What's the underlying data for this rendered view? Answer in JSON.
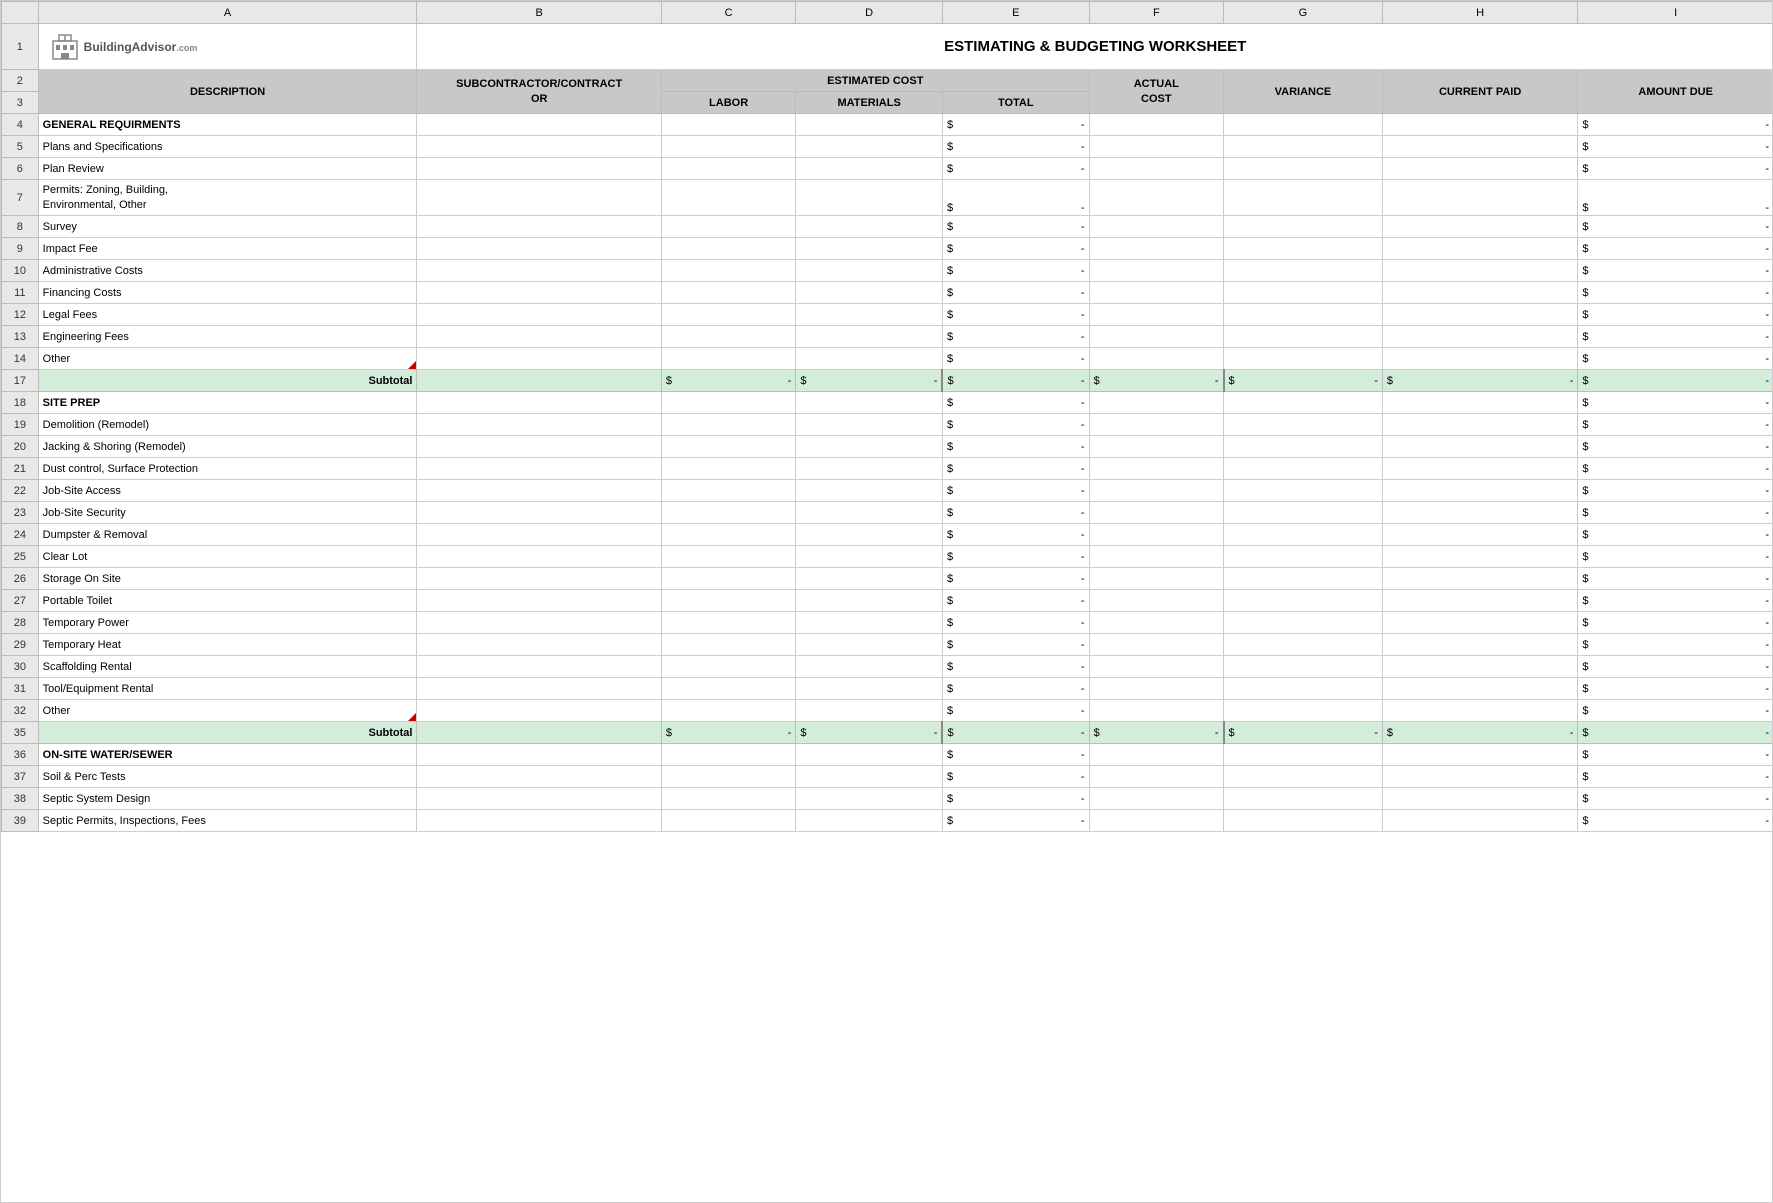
{
  "title": "ESTIMATING & BUDGETING WORKSHEET",
  "logo": {
    "text": "BuildingAdvisor",
    "domain": ".com"
  },
  "columns": {
    "letters": [
      "",
      "A",
      "B",
      "C",
      "D",
      "E",
      "F",
      "G",
      "H",
      "I"
    ],
    "headers_row2": {
      "a": "DESCRIPTION",
      "b": "SUBCONTRACTOR/CONTRACT OR",
      "estimated_cost": "ESTIMATED COST",
      "f": "ACTUAL COST",
      "g": "VARIANCE",
      "h": "CURRENT PAID",
      "i": "AMOUNT DUE"
    },
    "headers_row3": {
      "c": "LABOR",
      "d": "MATERIALS",
      "e": "TOTAL"
    }
  },
  "sections": [
    {
      "name": "GENERAL REQUIRMENTS",
      "row_start": 4,
      "items": [
        {
          "row": 4,
          "label": "GENERAL REQUIRMENTS",
          "bold": true,
          "total": "$ -",
          "amount_due": "$ -"
        },
        {
          "row": 5,
          "label": "Plans and Specifications",
          "total": "$ -",
          "amount_due": "$ -"
        },
        {
          "row": 6,
          "label": "Plan Review",
          "total": "$ -",
          "amount_due": "$ -"
        },
        {
          "row": 7,
          "label": "Permits: Zoning, Building,\nEnvironmental, Other",
          "total": "$ -",
          "amount_due": "$ -"
        },
        {
          "row": 8,
          "label": "Survey",
          "total": "$ -",
          "amount_due": "$ -"
        },
        {
          "row": 9,
          "label": "Impact Fee",
          "total": "$ -",
          "amount_due": "$ -"
        },
        {
          "row": 10,
          "label": "Administrative Costs",
          "total": "$ -",
          "amount_due": "$ -"
        },
        {
          "row": 11,
          "label": "Financing Costs",
          "total": "$ -",
          "amount_due": "$ -"
        },
        {
          "row": 12,
          "label": "Legal Fees",
          "total": "$ -",
          "amount_due": "$ -"
        },
        {
          "row": 13,
          "label": "Engineering Fees",
          "total": "$ -",
          "amount_due": "$ -"
        },
        {
          "row": 14,
          "label": "Other",
          "has_triangle": true,
          "total": "$ -",
          "amount_due": "$ -"
        }
      ],
      "subtotal_row": 17,
      "subtotal_values": {
        "labor": "$ -",
        "materials": "$ -",
        "total": "$ -",
        "actual": "$ -",
        "variance": "$ -",
        "current_paid": "$ -",
        "amount_due": "$ -"
      }
    },
    {
      "name": "SITE PREP",
      "row_start": 18,
      "items": [
        {
          "row": 18,
          "label": "SITE PREP",
          "bold": true,
          "total": "$ -",
          "amount_due": "$ -"
        },
        {
          "row": 19,
          "label": "Demolition (Remodel)",
          "total": "$ -",
          "amount_due": "$ -"
        },
        {
          "row": 20,
          "label": "Jacking & Shoring (Remodel)",
          "total": "$ -",
          "amount_due": "$ -"
        },
        {
          "row": 21,
          "label": "Dust control, Surface Protection",
          "total": "$ -",
          "amount_due": "$ -"
        },
        {
          "row": 22,
          "label": "Job-Site Access",
          "total": "$ -",
          "amount_due": "$ -"
        },
        {
          "row": 23,
          "label": "Job-Site Security",
          "total": "$ -",
          "amount_due": "$ -"
        },
        {
          "row": 24,
          "label": "Dumpster & Removal",
          "total": "$ -",
          "amount_due": "$ -"
        },
        {
          "row": 25,
          "label": "Clear Lot",
          "total": "$ -",
          "amount_due": "$ -"
        },
        {
          "row": 26,
          "label": "Storage On Site",
          "total": "$ -",
          "amount_due": "$ -"
        },
        {
          "row": 27,
          "label": "Portable Toilet",
          "total": "$ -",
          "amount_due": "$ -"
        },
        {
          "row": 28,
          "label": "Temporary Power",
          "total": "$ -",
          "amount_due": "$ -"
        },
        {
          "row": 29,
          "label": "Temporary Heat",
          "total": "$ -",
          "amount_due": "$ -"
        },
        {
          "row": 30,
          "label": "Scaffolding Rental",
          "total": "$ -",
          "amount_due": "$ -"
        },
        {
          "row": 31,
          "label": "Tool/Equipment Rental",
          "total": "$ -",
          "amount_due": "$ -"
        },
        {
          "row": 32,
          "label": "Other",
          "has_triangle": true,
          "total": "$ -",
          "amount_due": "$ -"
        }
      ],
      "subtotal_row": 35,
      "subtotal_values": {
        "labor": "$ -",
        "materials": "$ -",
        "total": "$ -",
        "actual": "$ -",
        "variance": "$ -",
        "current_paid": "$ -",
        "amount_due": "$ -"
      }
    },
    {
      "name": "ON-SITE WATER/SEWER",
      "row_start": 36,
      "items": [
        {
          "row": 36,
          "label": "ON-SITE WATER/SEWER",
          "bold": true,
          "total": "$ -",
          "amount_due": "$ -"
        },
        {
          "row": 37,
          "label": "Soil & Perc Tests",
          "total": "$ -",
          "amount_due": "$ -"
        },
        {
          "row": 38,
          "label": "Septic System Design",
          "total": "$ -",
          "amount_due": "$ -"
        },
        {
          "row": 39,
          "label": "Septic Permits, Inspections, Fees",
          "total": "$ -",
          "amount_due": "$ -"
        }
      ]
    }
  ],
  "subtotal_label": "Subtotal",
  "dollar_dash": "$ -",
  "colors": {
    "header_bg": "#c8c8c8",
    "subtotal_bg": "#d4edda",
    "col_header_bg": "#e8e8e8",
    "border": "#cccccc",
    "dark_border": "#bbbbbb"
  }
}
